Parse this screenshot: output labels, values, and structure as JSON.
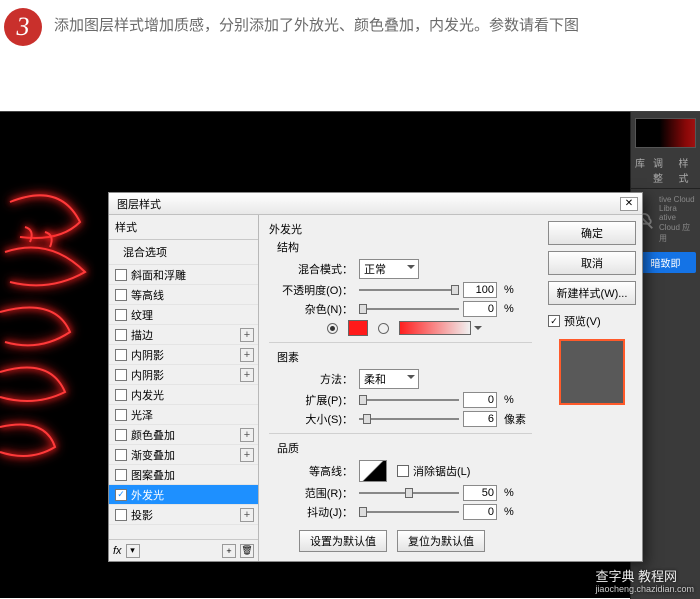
{
  "step": {
    "number": "3",
    "text": "添加图层样式增加质感，分别添加了外放光、颜色叠加，内发光。参数请看下图"
  },
  "panels": {
    "tabs": [
      "库",
      "调整",
      "样式"
    ],
    "cc_text_1": "tive Cloud Libra",
    "cc_text_2": "ative Cloud 应用",
    "blue_btn": "暗致即"
  },
  "dialog": {
    "title": "图层样式",
    "styles_header": "样式",
    "blend_header": "混合选项",
    "items": [
      {
        "label": "斜面和浮雕",
        "checked": false,
        "plus": false
      },
      {
        "label": "等高线",
        "checked": false,
        "plus": false
      },
      {
        "label": "纹理",
        "checked": false,
        "plus": false
      },
      {
        "label": "描边",
        "checked": false,
        "plus": true
      },
      {
        "label": "内阴影",
        "checked": false,
        "plus": true
      },
      {
        "label": "内阴影",
        "checked": false,
        "plus": true
      },
      {
        "label": "内发光",
        "checked": false,
        "plus": false
      },
      {
        "label": "光泽",
        "checked": false,
        "plus": false
      },
      {
        "label": "颜色叠加",
        "checked": false,
        "plus": true
      },
      {
        "label": "渐变叠加",
        "checked": false,
        "plus": true
      },
      {
        "label": "图案叠加",
        "checked": false,
        "plus": false
      },
      {
        "label": "外发光",
        "checked": true,
        "plus": false,
        "selected": true
      },
      {
        "label": "投影",
        "checked": false,
        "plus": true
      }
    ],
    "section": {
      "title": "外发光",
      "structure": "结构",
      "blend_mode_label": "混合模式：",
      "blend_mode_value": "正常",
      "opacity_label": "不透明度(O)：",
      "opacity_value": "100",
      "opacity_unit": "%",
      "noise_label": "杂色(N)：",
      "noise_value": "0",
      "noise_unit": "%",
      "elements_title": "图素",
      "technique_label": "方法：",
      "technique_value": "柔和",
      "spread_label": "扩展(P)：",
      "spread_value": "0",
      "spread_unit": "%",
      "size_label": "大小(S)：",
      "size_value": "6",
      "size_unit": "像素",
      "quality_title": "品质",
      "contour_label": "等高线：",
      "antialias_label": "消除锯齿(L)",
      "range_label": "范围(R)：",
      "range_value": "50",
      "range_unit": "%",
      "jitter_label": "抖动(J)：",
      "jitter_value": "0",
      "jitter_unit": "%",
      "btn_default": "设置为默认值",
      "btn_reset": "复位为默认值"
    },
    "buttons": {
      "ok": "确定",
      "cancel": "取消",
      "new_style": "新建样式(W)...",
      "preview": "预览(V)"
    }
  },
  "watermark": {
    "main": "查字典 教程网",
    "sub": "jiaocheng.chazidian.com"
  }
}
